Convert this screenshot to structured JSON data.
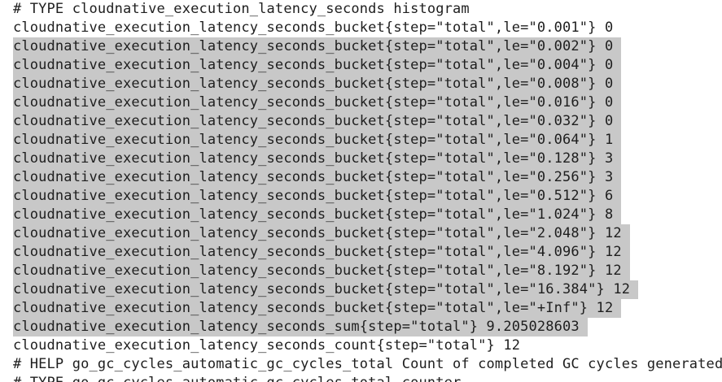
{
  "document": {
    "lines": [
      "# TYPE cloudnative_execution_latency_seconds histogram",
      "cloudnative_execution_latency_seconds_bucket{step=\"total\",le=\"0.001\"} 0",
      "cloudnative_execution_latency_seconds_bucket{step=\"total\",le=\"0.002\"} 0",
      "cloudnative_execution_latency_seconds_bucket{step=\"total\",le=\"0.004\"} 0",
      "cloudnative_execution_latency_seconds_bucket{step=\"total\",le=\"0.008\"} 0",
      "cloudnative_execution_latency_seconds_bucket{step=\"total\",le=\"0.016\"} 0",
      "cloudnative_execution_latency_seconds_bucket{step=\"total\",le=\"0.032\"} 0",
      "cloudnative_execution_latency_seconds_bucket{step=\"total\",le=\"0.064\"} 1",
      "cloudnative_execution_latency_seconds_bucket{step=\"total\",le=\"0.128\"} 3",
      "cloudnative_execution_latency_seconds_bucket{step=\"total\",le=\"0.256\"} 3",
      "cloudnative_execution_latency_seconds_bucket{step=\"total\",le=\"0.512\"} 6",
      "cloudnative_execution_latency_seconds_bucket{step=\"total\",le=\"1.024\"} 8",
      "cloudnative_execution_latency_seconds_bucket{step=\"total\",le=\"2.048\"} 12",
      "cloudnative_execution_latency_seconds_bucket{step=\"total\",le=\"4.096\"} 12",
      "cloudnative_execution_latency_seconds_bucket{step=\"total\",le=\"8.192\"} 12",
      "cloudnative_execution_latency_seconds_bucket{step=\"total\",le=\"16.384\"} 12",
      "cloudnative_execution_latency_seconds_bucket{step=\"total\",le=\"+Inf\"} 12",
      "cloudnative_execution_latency_seconds_sum{step=\"total\"} 9.205028603",
      "cloudnative_execution_latency_seconds_count{step=\"total\"} 12",
      "# HELP go_gc_cycles_automatic_gc_cycles_total Count of completed GC cycles generated by th",
      "# TYPE go_gc_cycles_automatic_gc_cycles_total counter"
    ],
    "selection": {
      "first_line": 3,
      "last_line": 18
    },
    "colors": {
      "selection": "#c8c8c8",
      "text": "#1e1e1e",
      "background": "#ffffff"
    }
  }
}
